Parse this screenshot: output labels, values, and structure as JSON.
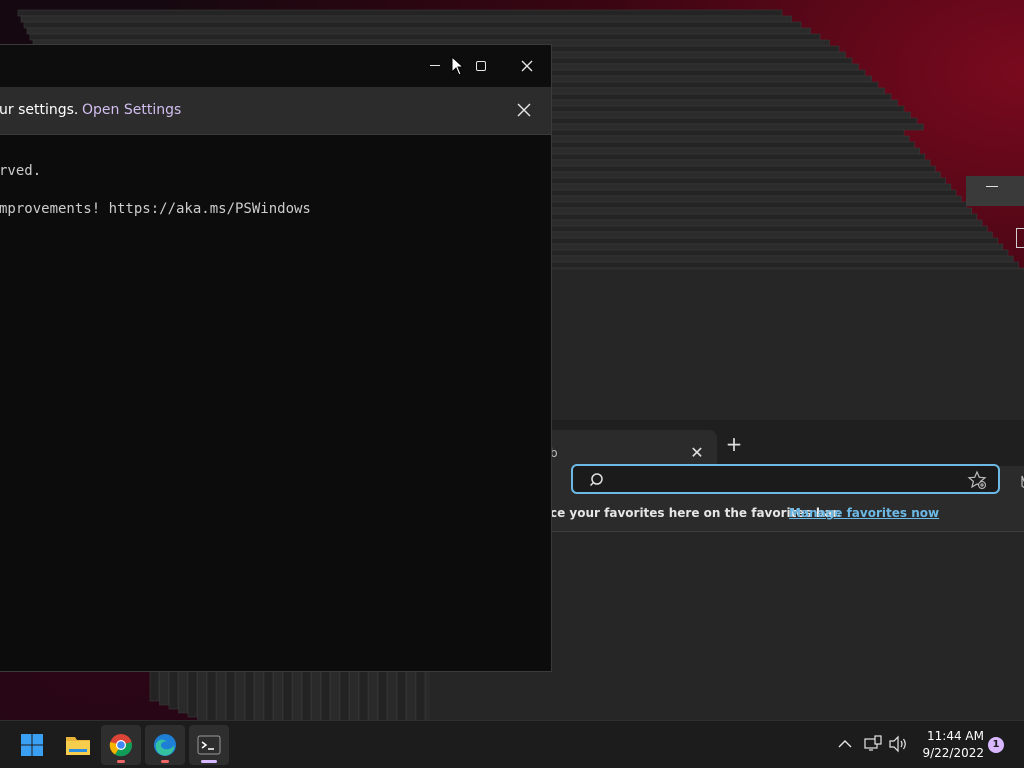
{
  "terminal": {
    "infobar_text": "ur settings.",
    "infobar_link": "Open Settings",
    "lines": [
      "rved.",
      "mprovements! https://aka.ms/PSWindows"
    ]
  },
  "edge": {
    "tab_fragment": "b",
    "address_value": "",
    "favbar_text": "ce your favorites here on the favorites bar.",
    "favbar_link": "Manage favorites now"
  },
  "taskbar": {
    "apps": [
      {
        "name": "start-icon"
      },
      {
        "name": "file-explorer-icon"
      },
      {
        "name": "chrome-icon"
      },
      {
        "name": "edge-icon"
      },
      {
        "name": "terminal-icon"
      }
    ],
    "clock_time": "11:44 AM",
    "clock_date": "9/22/2022",
    "notification_count": "1"
  },
  "colors": {
    "accent_link": "#6cb9e6",
    "terminal_bg": "#0c0c0c",
    "notif_badge": "#d9b8ff"
  }
}
